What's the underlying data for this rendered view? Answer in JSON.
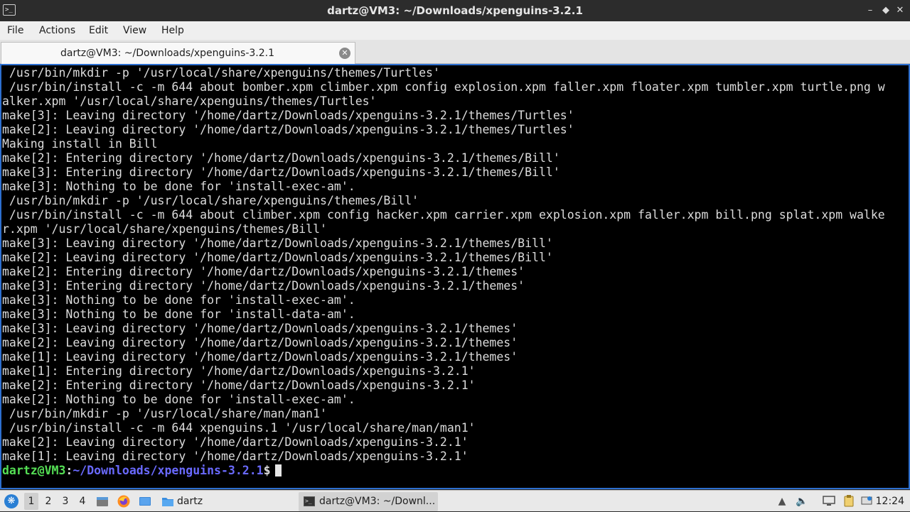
{
  "window": {
    "title": "dartz@VM3: ~/Downloads/xpenguins-3.2.1",
    "controls": [
      "minimize-icon",
      "maximize-icon",
      "close-icon"
    ]
  },
  "menu": {
    "items": [
      "File",
      "Actions",
      "Edit",
      "View",
      "Help"
    ]
  },
  "tab": {
    "label": "dartz@VM3: ~/Downloads/xpenguins-3.2.1"
  },
  "terminal": {
    "lines": [
      " /usr/bin/mkdir -p '/usr/local/share/xpenguins/themes/Turtles'",
      " /usr/bin/install -c -m 644 about bomber.xpm climber.xpm config explosion.xpm faller.xpm floater.xpm tumbler.xpm turtle.png w",
      "alker.xpm '/usr/local/share/xpenguins/themes/Turtles'",
      "make[3]: Leaving directory '/home/dartz/Downloads/xpenguins-3.2.1/themes/Turtles'",
      "make[2]: Leaving directory '/home/dartz/Downloads/xpenguins-3.2.1/themes/Turtles'",
      "Making install in Bill",
      "make[2]: Entering directory '/home/dartz/Downloads/xpenguins-3.2.1/themes/Bill'",
      "make[3]: Entering directory '/home/dartz/Downloads/xpenguins-3.2.1/themes/Bill'",
      "make[3]: Nothing to be done for 'install-exec-am'.",
      " /usr/bin/mkdir -p '/usr/local/share/xpenguins/themes/Bill'",
      " /usr/bin/install -c -m 644 about climber.xpm config hacker.xpm carrier.xpm explosion.xpm faller.xpm bill.png splat.xpm walke",
      "r.xpm '/usr/local/share/xpenguins/themes/Bill'",
      "make[3]: Leaving directory '/home/dartz/Downloads/xpenguins-3.2.1/themes/Bill'",
      "make[2]: Leaving directory '/home/dartz/Downloads/xpenguins-3.2.1/themes/Bill'",
      "make[2]: Entering directory '/home/dartz/Downloads/xpenguins-3.2.1/themes'",
      "make[3]: Entering directory '/home/dartz/Downloads/xpenguins-3.2.1/themes'",
      "make[3]: Nothing to be done for 'install-exec-am'.",
      "make[3]: Nothing to be done for 'install-data-am'.",
      "make[3]: Leaving directory '/home/dartz/Downloads/xpenguins-3.2.1/themes'",
      "make[2]: Leaving directory '/home/dartz/Downloads/xpenguins-3.2.1/themes'",
      "make[1]: Leaving directory '/home/dartz/Downloads/xpenguins-3.2.1/themes'",
      "make[1]: Entering directory '/home/dartz/Downloads/xpenguins-3.2.1'",
      "make[2]: Entering directory '/home/dartz/Downloads/xpenguins-3.2.1'",
      "make[2]: Nothing to be done for 'install-exec-am'.",
      " /usr/bin/mkdir -p '/usr/local/share/man/man1'",
      " /usr/bin/install -c -m 644 xpenguins.1 '/usr/local/share/man/man1'",
      "make[2]: Leaving directory '/home/dartz/Downloads/xpenguins-3.2.1'",
      "make[1]: Leaving directory '/home/dartz/Downloads/xpenguins-3.2.1'"
    ],
    "prompt": {
      "user_host": "dartz@VM3",
      "colon": ":",
      "path": "~/Downloads/xpenguins-3.2.1",
      "symbol": "$"
    },
    "colors": {
      "background": "#000000",
      "text": "#dcdcdc",
      "prompt_user": "#55e055",
      "prompt_path": "#6a6aff",
      "focus_border": "#2d6fd0"
    }
  },
  "taskbar": {
    "start_icon": "start-menu-icon",
    "workspaces": [
      "1",
      "2",
      "3",
      "4"
    ],
    "active_workspace": "1",
    "quick_launch": [
      "file-manager-icon",
      "firefox-icon",
      "show-desktop-icon"
    ],
    "folder_label": "dartz",
    "task_label": "dartz@VM3: ~/Downl...",
    "tray_icons": [
      "tray-up-icon",
      "volume-icon",
      "display-icon",
      "clipboard-icon",
      "network-icon"
    ],
    "clock": "12:24"
  }
}
